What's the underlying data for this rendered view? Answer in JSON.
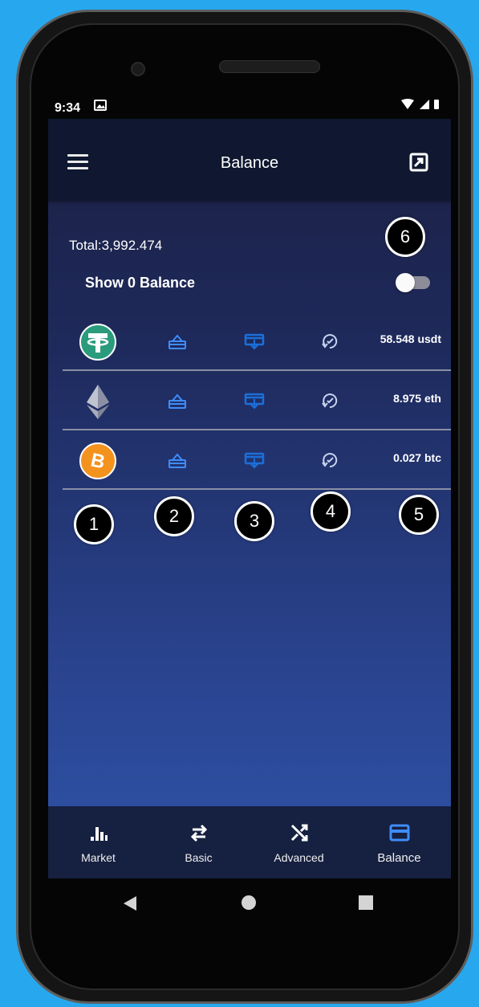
{
  "status_bar": {
    "time": "9:34",
    "icons": [
      "photo-icon",
      "wifi-icon",
      "signal-icon",
      "battery-icon"
    ]
  },
  "app_bar": {
    "title": "Balance",
    "menu_icon": "hamburger-menu-icon",
    "action_icon": "share-export-icon"
  },
  "summary": {
    "total": "Total:3,992.474",
    "show_zero_label": "Show 0 Balance",
    "show_zero_enabled": false
  },
  "coins": [
    {
      "symbol": "usdt",
      "balance": "58.548 usdt",
      "logo": "tether-logo",
      "color": "#2a9b7c"
    },
    {
      "symbol": "eth",
      "balance": "8.975 eth",
      "logo": "ethereum-logo",
      "color": "#c0c4d0"
    },
    {
      "symbol": "btc",
      "balance": "0.027 btc",
      "logo": "bitcoin-logo",
      "color": "#f4921e"
    }
  ],
  "row_actions": [
    "send-icon",
    "receive-icon",
    "history-icon"
  ],
  "callouts": [
    "1",
    "2",
    "3",
    "4",
    "5",
    "6"
  ],
  "bottom_nav": {
    "tabs": [
      {
        "label": "Market",
        "icon": "bar-chart-icon"
      },
      {
        "label": "Basic",
        "icon": "swap-arrows-icon"
      },
      {
        "label": "Advanced",
        "icon": "shuffle-icon"
      },
      {
        "label": "Balance",
        "icon": "credit-card-icon"
      }
    ],
    "active": "Balance"
  },
  "system_nav": [
    "back-icon",
    "home-icon",
    "recents-icon"
  ],
  "colors": {
    "accent": "#3f8dfb",
    "action_icon": "#3f8dfb",
    "appbar": "#0f1830",
    "background_top": "#1c2042",
    "background_bottom": "#2f53a8"
  }
}
